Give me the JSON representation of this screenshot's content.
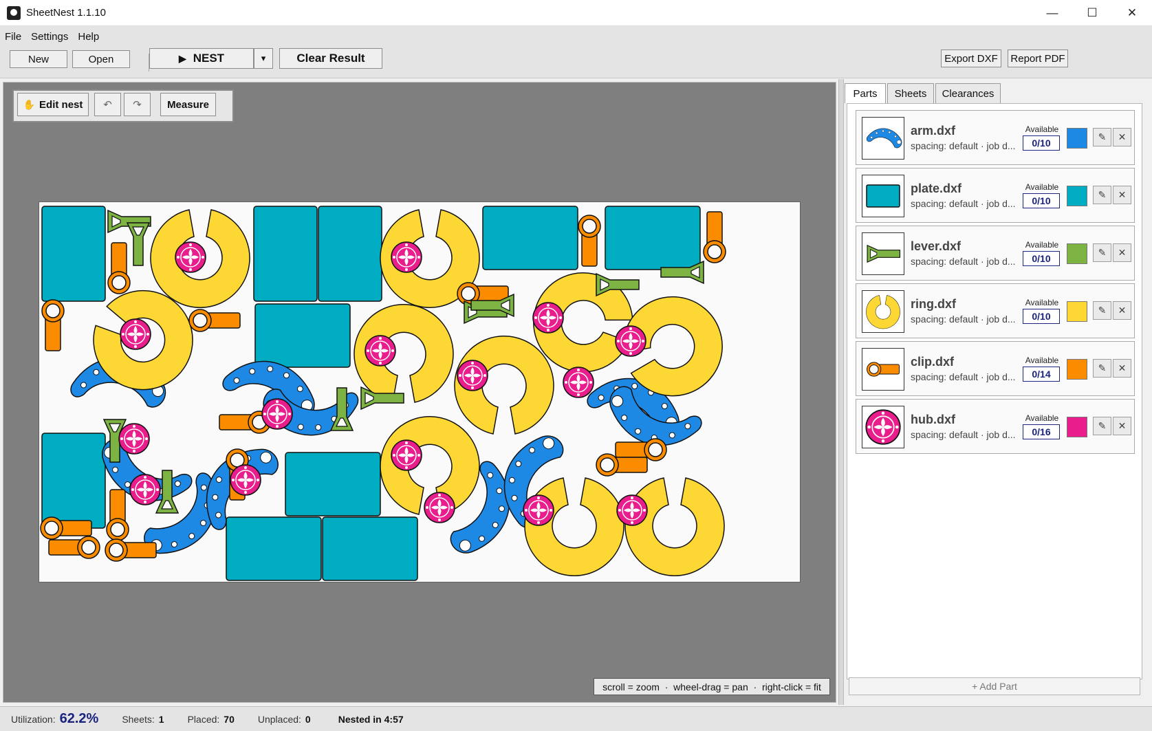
{
  "window": {
    "title": "SheetNest 1.1.10"
  },
  "menu": [
    "File",
    "Settings",
    "Help"
  ],
  "toolbar": {
    "new_label": "New",
    "open_label": "Open",
    "nest_label": "NEST",
    "nest_dropdown": "▾",
    "clear_label": "Clear Result",
    "export_dxf_label": "Export DXF",
    "report_pdf_label": "Report PDF"
  },
  "edit_toolbar": {
    "edit_nest_label": "Edit nest",
    "undo": "↶",
    "redo": "↷",
    "measure_label": "Measure"
  },
  "canvas": {
    "hint": "scroll = zoom  ·  wheel-drag = pan  ·  right-click = fit"
  },
  "tabs": [
    "Parts",
    "Sheets",
    "Clearances"
  ],
  "available_label": "Available",
  "parts": [
    {
      "name": "arm.dxf",
      "meta": "spacing: default · job d...",
      "available": "0/10",
      "color": "#1e88e5",
      "icon": "arm-shape-icon"
    },
    {
      "name": "plate.dxf",
      "meta": "spacing: default · job d...",
      "available": "0/10",
      "color": "#00acc1",
      "icon": "plate-shape-icon"
    },
    {
      "name": "lever.dxf",
      "meta": "spacing: default · job d...",
      "available": "0/10",
      "color": "#7cb342",
      "icon": "lever-shape-icon"
    },
    {
      "name": "ring.dxf",
      "meta": "spacing: default · job d...",
      "available": "0/10",
      "color": "#fdd835",
      "icon": "ring-shape-icon"
    },
    {
      "name": "clip.dxf",
      "meta": "spacing: default · job d...",
      "available": "0/14",
      "color": "#fb8c00",
      "icon": "clip-shape-icon"
    },
    {
      "name": "hub.dxf",
      "meta": "spacing: default · job d...",
      "available": "0/16",
      "color": "#e91e8c",
      "icon": "hub-shape-icon"
    }
  ],
  "add_part_label": "+ Add Part",
  "status": {
    "utilization_label": "Utilization:",
    "utilization": "62.2%",
    "sheets_label": "Sheets:",
    "sheets": "1",
    "placed_label": "Placed:",
    "placed": "70",
    "unplaced_label": "Unplaced:",
    "unplaced": "0",
    "nested": "Nested in 4:57"
  }
}
